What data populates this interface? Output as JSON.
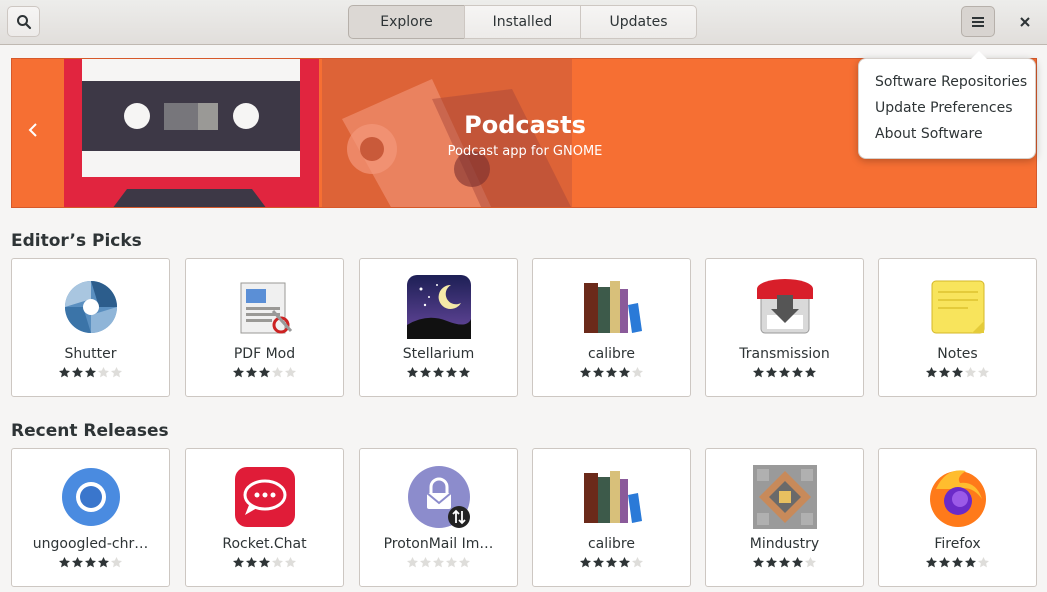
{
  "header": {
    "tabs": [
      {
        "label": "Explore",
        "active": true
      },
      {
        "label": "Installed",
        "active": false
      },
      {
        "label": "Updates",
        "active": false
      }
    ],
    "search_icon": "search-icon",
    "menu_icon": "hamburger-menu-icon",
    "close_icon": "close-icon"
  },
  "banner": {
    "title": "Podcasts",
    "subtitle": "Podcast app for GNOME",
    "bg_color": "#f66f33"
  },
  "menu": {
    "items": [
      "Software Repositories",
      "Update Preferences",
      "About Software"
    ]
  },
  "editors_picks": {
    "title": "Editor’s Picks",
    "apps": [
      {
        "name": "Shutter",
        "rating": 3,
        "icon": "shutter-icon"
      },
      {
        "name": "PDF Mod",
        "rating": 3,
        "icon": "pdf-mod-icon"
      },
      {
        "name": "Stellarium",
        "rating": 5,
        "icon": "stellarium-icon"
      },
      {
        "name": "calibre",
        "rating": 4,
        "icon": "calibre-icon"
      },
      {
        "name": "Transmission",
        "rating": 5,
        "icon": "transmission-icon"
      },
      {
        "name": "Notes",
        "rating": 3,
        "icon": "notes-icon"
      }
    ]
  },
  "recent_releases": {
    "title": "Recent Releases",
    "apps": [
      {
        "name": "ungoogled-chr…",
        "rating": 4,
        "icon": "chromium-icon"
      },
      {
        "name": "Rocket.Chat",
        "rating": 3,
        "icon": "rocket-chat-icon"
      },
      {
        "name": "ProtonMail Im…",
        "rating": 0,
        "icon": "protonmail-icon"
      },
      {
        "name": "calibre",
        "rating": 4,
        "icon": "calibre-icon"
      },
      {
        "name": "Mindustry",
        "rating": 4,
        "icon": "mindustry-icon"
      },
      {
        "name": "Firefox",
        "rating": 4,
        "icon": "firefox-icon"
      }
    ]
  }
}
